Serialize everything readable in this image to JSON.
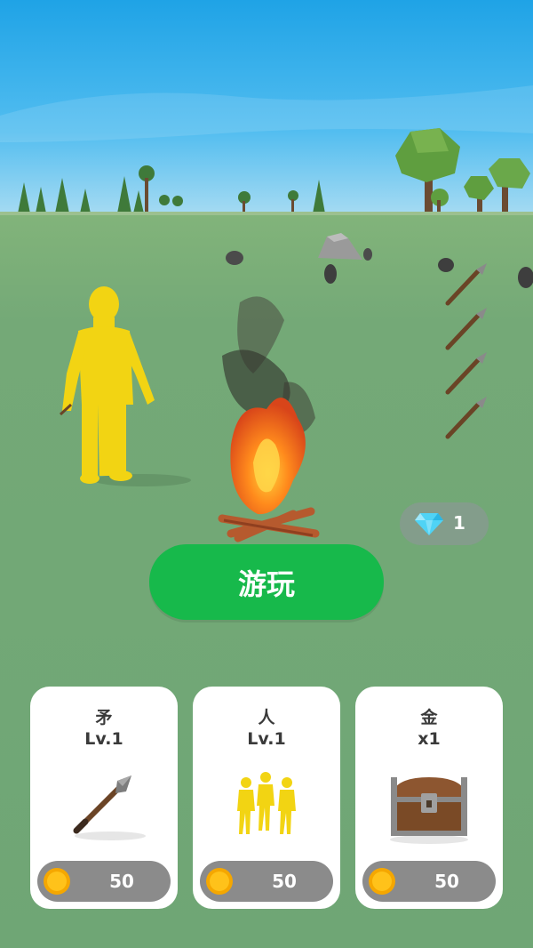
{
  "hud": {
    "gem_count": "1",
    "gem_icon": "diamond-icon"
  },
  "play_button": {
    "label": "游玩"
  },
  "upgrades": [
    {
      "title": "矛",
      "level": "Lv.1",
      "price": "50",
      "icon": "spear-icon",
      "currency_icon": "coin-icon"
    },
    {
      "title": "人",
      "level": "Lv.1",
      "price": "50",
      "icon": "three-people-icon",
      "currency_icon": "coin-icon"
    },
    {
      "title": "金",
      "level": "x1",
      "price": "50",
      "icon": "treasure-chest-icon",
      "currency_icon": "coin-icon"
    }
  ],
  "colors": {
    "play_button": "#17b94b",
    "grass": "#6fa675",
    "sky_top": "#1fa3e6",
    "card_bg": "#ffffff",
    "price_pill": "#8b8b8b",
    "coin": "#f5a700"
  }
}
